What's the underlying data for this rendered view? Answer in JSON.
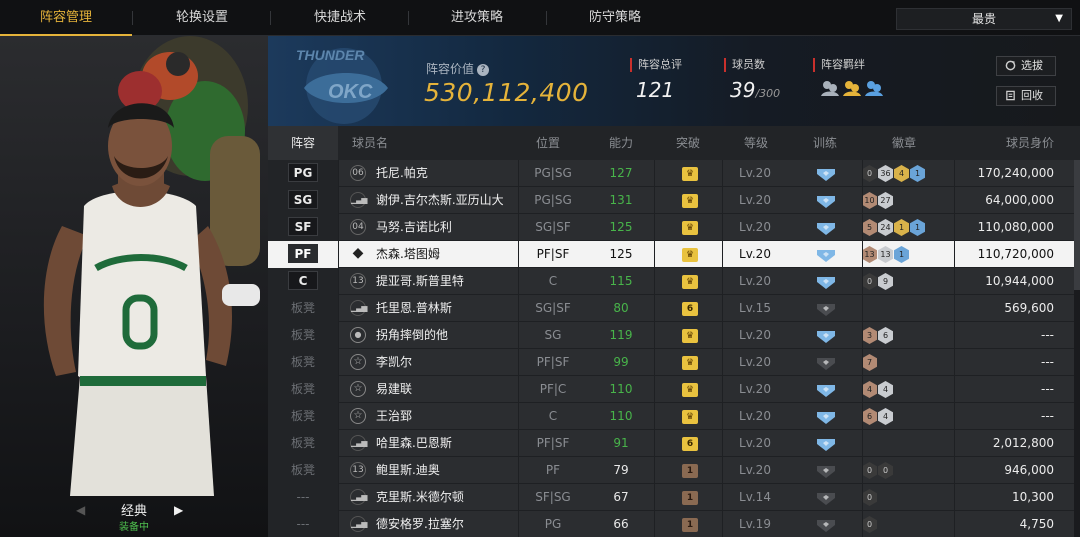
{
  "tabs": [
    {
      "label": "阵容管理",
      "active": true
    },
    {
      "label": "轮换设置",
      "active": false
    },
    {
      "label": "快捷战术",
      "active": false
    },
    {
      "label": "进攻策略",
      "active": false
    },
    {
      "label": "防守策略",
      "active": false
    }
  ],
  "sort": {
    "selected": "最贵"
  },
  "left": {
    "style_name": "经典",
    "status": "装备中"
  },
  "header": {
    "team_logo_text": "THUNDER",
    "value_label": "阵容价值",
    "value": "530,112,400",
    "rating_label": "阵容总评",
    "rating": "121",
    "count_label": "球员数",
    "count": "39",
    "count_max": "/300",
    "chem_label": "阵容羁绊",
    "scout_button": "选拔",
    "recycle_button": "回收"
  },
  "columns": {
    "slot": "阵容",
    "name": "球员名",
    "pos": "位置",
    "ovr": "能力",
    "brk": "突破",
    "lvl": "等级",
    "train": "训练",
    "badge": "徽章",
    "price": "球员身价"
  },
  "colors": {
    "accent": "#e5b33a",
    "ovr_green": "#48b44a",
    "badge_blue": "#6aa4d8"
  },
  "rows": [
    {
      "slot": "PG",
      "starter": true,
      "num": "06",
      "name": "托尼.帕克",
      "pos": "PG|SG",
      "ovr": "127",
      "ovr_color": "green",
      "brk": "crown",
      "lvl": "Lv.20",
      "train": "blue",
      "badges": [
        [
          "hof",
          "0"
        ],
        [
          "silver",
          "36"
        ],
        [
          "gold",
          "4"
        ],
        [
          "blue",
          "1"
        ]
      ],
      "price": "170,240,000"
    },
    {
      "slot": "SG",
      "starter": true,
      "num": "bars",
      "name": "谢伊.吉尔杰斯.亚历山大",
      "pos": "PG|SG",
      "ovr": "131",
      "ovr_color": "green",
      "brk": "crown",
      "lvl": "Lv.20",
      "train": "blue",
      "badges": [
        [
          "bronze",
          "10"
        ],
        [
          "silver",
          "27"
        ]
      ],
      "price": "64,000,000"
    },
    {
      "slot": "SF",
      "starter": true,
      "num": "04",
      "name": "马努.吉诺比利",
      "pos": "SG|SF",
      "ovr": "125",
      "ovr_color": "green",
      "brk": "crown",
      "lvl": "Lv.20",
      "train": "blue",
      "badges": [
        [
          "bronze",
          "5"
        ],
        [
          "silver",
          "24"
        ],
        [
          "gold",
          "1"
        ],
        [
          "blue",
          "1"
        ]
      ],
      "price": "110,080,000"
    },
    {
      "slot": "PF",
      "starter": true,
      "selected": true,
      "num": "diamond",
      "name": "杰森.塔图姆",
      "pos": "PF|SF",
      "ovr": "125",
      "ovr_color": "white",
      "brk": "crown",
      "lvl": "Lv.20",
      "train": "blue",
      "badges": [
        [
          "bronze",
          "13"
        ],
        [
          "silver",
          "13"
        ],
        [
          "blue",
          "1"
        ]
      ],
      "price": "110,720,000"
    },
    {
      "slot": "C",
      "starter": true,
      "num": "13",
      "name": "提亚哥.斯普里特",
      "pos": "C",
      "ovr": "115",
      "ovr_color": "green",
      "brk": "crown",
      "lvl": "Lv.20",
      "train": "blue",
      "badges": [
        [
          "hof",
          "0"
        ],
        [
          "silver",
          "9"
        ]
      ],
      "price": "10,944,000"
    },
    {
      "slot": "板凳",
      "starter": false,
      "num": "bars",
      "name": "托里恩.普林斯",
      "pos": "SG|SF",
      "ovr": "80",
      "ovr_color": "green",
      "brk": "6",
      "lvl": "Lv.15",
      "train": "gray",
      "badges": [],
      "price": "569,600"
    },
    {
      "slot": "板凳",
      "starter": false,
      "num": "person",
      "name": "拐角摔倒的他",
      "pos": "SG",
      "ovr": "119",
      "ovr_color": "green",
      "brk": "crown",
      "lvl": "Lv.20",
      "train": "blue",
      "badges": [
        [
          "bronze",
          "3"
        ],
        [
          "silver",
          "6"
        ]
      ],
      "price": "---"
    },
    {
      "slot": "板凳",
      "starter": false,
      "num": "star",
      "name": "李凯尔",
      "pos": "PF|SF",
      "ovr": "99",
      "ovr_color": "green",
      "brk": "crown",
      "lvl": "Lv.20",
      "train": "gray",
      "badges": [
        [
          "bronze",
          "7"
        ]
      ],
      "price": "---"
    },
    {
      "slot": "板凳",
      "starter": false,
      "num": "star",
      "name": "易建联",
      "pos": "PF|C",
      "ovr": "110",
      "ovr_color": "green",
      "brk": "crown",
      "lvl": "Lv.20",
      "train": "blue",
      "badges": [
        [
          "bronze",
          "4"
        ],
        [
          "silver",
          "4"
        ]
      ],
      "price": "---"
    },
    {
      "slot": "板凳",
      "starter": false,
      "num": "star",
      "name": "王治郅",
      "pos": "C",
      "ovr": "110",
      "ovr_color": "green",
      "brk": "crown",
      "lvl": "Lv.20",
      "train": "blue",
      "badges": [
        [
          "bronze",
          "6"
        ],
        [
          "silver",
          "4"
        ]
      ],
      "price": "---"
    },
    {
      "slot": "板凳",
      "starter": false,
      "num": "bars",
      "name": "哈里森.巴恩斯",
      "pos": "PF|SF",
      "ovr": "91",
      "ovr_color": "green",
      "brk": "6",
      "lvl": "Lv.20",
      "train": "blue",
      "badges": [],
      "price": "2,012,800"
    },
    {
      "slot": "板凳",
      "starter": false,
      "num": "13",
      "name": "鲍里斯.迪奥",
      "pos": "PF",
      "ovr": "79",
      "ovr_color": "white",
      "brk": "1",
      "lvl": "Lv.20",
      "train": "gray",
      "badges": [
        [
          "hof",
          "0"
        ],
        [
          "hof",
          "0"
        ]
      ],
      "price": "946,000"
    },
    {
      "slot": "---",
      "starter": false,
      "num": "bars",
      "name": "克里斯.米德尔顿",
      "pos": "SF|SG",
      "ovr": "67",
      "ovr_color": "white",
      "brk": "1",
      "lvl": "Lv.14",
      "train": "gray",
      "badges": [
        [
          "hof",
          "0"
        ]
      ],
      "price": "10,300"
    },
    {
      "slot": "---",
      "starter": false,
      "num": "bars",
      "name": "德安格罗.拉塞尔",
      "pos": "PG",
      "ovr": "66",
      "ovr_color": "white",
      "brk": "1",
      "lvl": "Lv.19",
      "train": "gray",
      "badges": [
        [
          "hof",
          "0"
        ]
      ],
      "price": "4,750"
    }
  ]
}
